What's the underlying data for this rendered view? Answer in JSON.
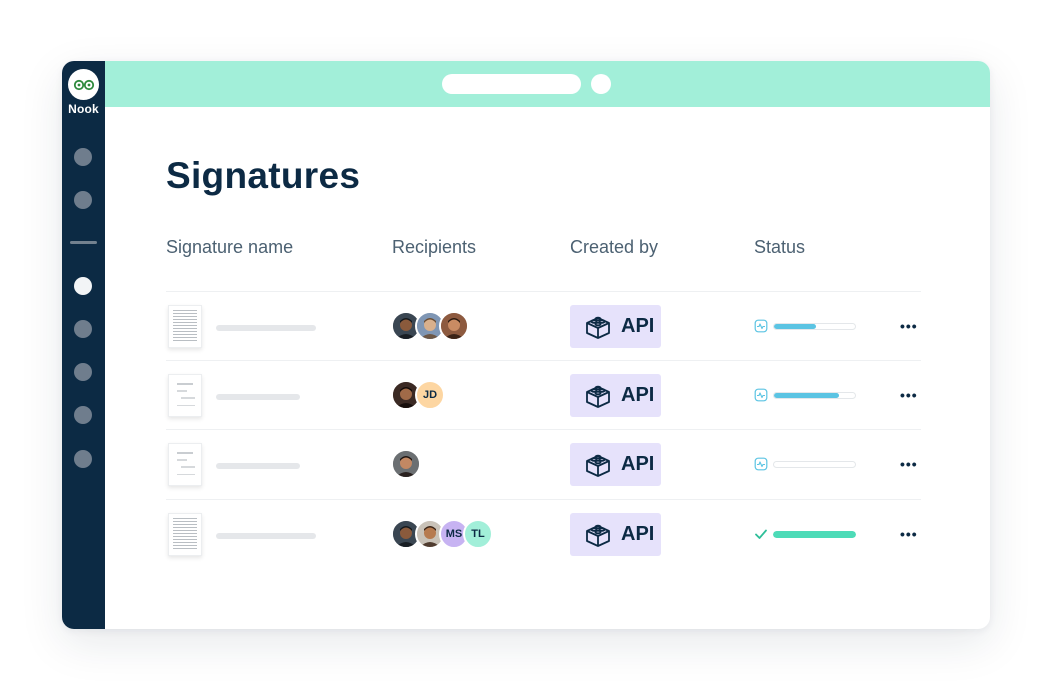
{
  "brand": {
    "name": "Nook",
    "accent": "#a2efd9",
    "sidebar_color": "#0c2a44"
  },
  "page": {
    "title": "Signatures"
  },
  "table": {
    "headers": {
      "name": "Signature name",
      "recipients": "Recipients",
      "created_by": "Created by",
      "status": "Status"
    },
    "rows": [
      {
        "doc_type": "dense-text",
        "recipients": [
          {
            "type": "photo",
            "icon": "person-photo-1"
          },
          {
            "type": "photo",
            "icon": "person-photo-2"
          },
          {
            "type": "photo",
            "icon": "person-photo-3"
          }
        ],
        "created_by": "API",
        "created_by_icon": "lego-brick-icon",
        "status": {
          "icon": "activity-icon",
          "progress": 0.52,
          "color": "#5bc4e3",
          "complete": false
        }
      },
      {
        "doc_type": "form",
        "recipients": [
          {
            "type": "photo",
            "icon": "person-photo-4"
          },
          {
            "type": "initials",
            "initials": "JD",
            "bg": "#fdd6a2"
          }
        ],
        "created_by": "API",
        "created_by_icon": "lego-brick-icon",
        "status": {
          "icon": "activity-icon",
          "progress": 0.8,
          "color": "#5bc4e3",
          "complete": false
        }
      },
      {
        "doc_type": "form",
        "recipients": [
          {
            "type": "photo",
            "icon": "person-photo-5"
          }
        ],
        "created_by": "API",
        "created_by_icon": "lego-brick-icon",
        "status": {
          "icon": "activity-icon",
          "progress": 0,
          "color": "#5bc4e3",
          "complete": false
        }
      },
      {
        "doc_type": "dense-text",
        "recipients": [
          {
            "type": "photo",
            "icon": "person-photo-1"
          },
          {
            "type": "photo",
            "icon": "person-photo-6"
          },
          {
            "type": "initials",
            "initials": "MS",
            "bg": "#c7b3f2"
          },
          {
            "type": "initials",
            "initials": "TL",
            "bg": "#a2efd9"
          }
        ],
        "created_by": "API",
        "created_by_icon": "lego-brick-icon",
        "status": {
          "icon": "check-icon",
          "progress": 1,
          "color": "#4ddbb7",
          "complete": true
        }
      }
    ]
  }
}
